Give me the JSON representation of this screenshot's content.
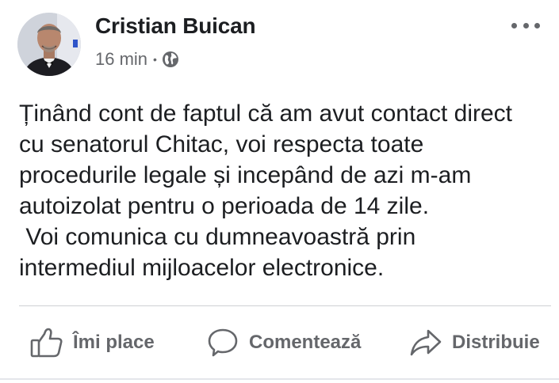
{
  "post": {
    "author": "Cristian Buican",
    "timestamp": "16 min",
    "separator": "•",
    "audience_icon": "globe-icon",
    "more_icon": "more-options-icon",
    "body_lines": [
      "Ținând cont de faptul că am avut contact direct",
      "cu senatorul Chitac, voi respecta toate",
      "procedurile legale și incepând de azi m-am",
      "autoizolat pentru o perioada de 14 zile.",
      " Voi comunica cu dumneavoastră prin",
      "intermediul mijloacelor electronice."
    ]
  },
  "actions": {
    "like_label": "Îmi place",
    "comment_label": "Comentează",
    "share_label": "Distribuie"
  },
  "colors": {
    "text": "#1c1e21",
    "secondary": "#65676b",
    "divider": "#ced0d4"
  }
}
